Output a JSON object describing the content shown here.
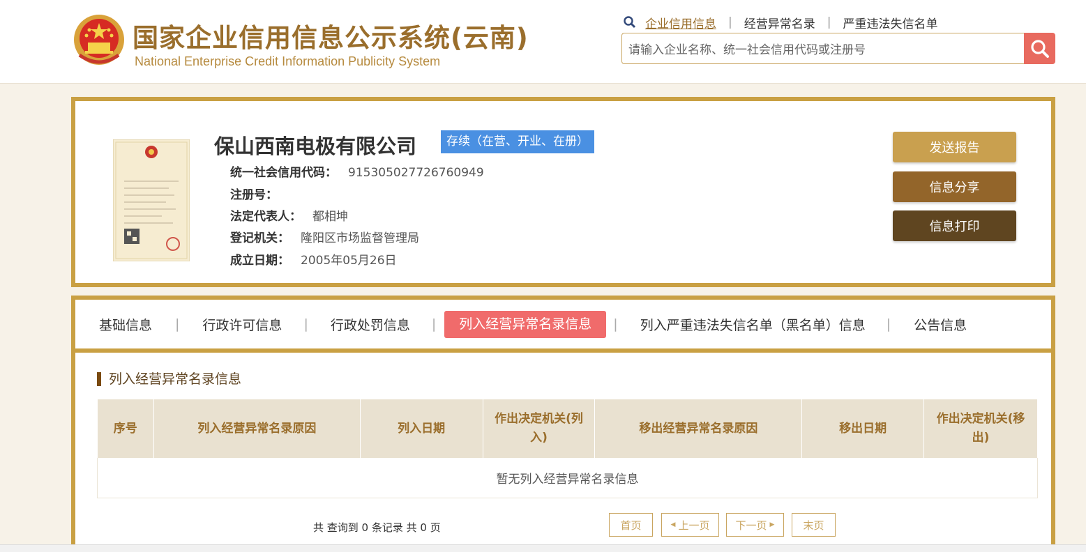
{
  "header": {
    "title": "国家企业信用信息公示系统(云南)",
    "subtitle": "National Enterprise Credit Information Publicity System",
    "nav": [
      "企业信用信息",
      "经营异常名录",
      "严重违法失信名单"
    ],
    "search_placeholder": "请输入企业名称、统一社会信用代码或注册号"
  },
  "company": {
    "name": "保山西南电极有限公司",
    "status": "存续（在营、开业、在册）",
    "license_title": "营业执照",
    "fields": [
      {
        "label": "统一社会信用代码：",
        "value": "915305027726760949"
      },
      {
        "label": "注册号：",
        "value": ""
      },
      {
        "label": "法定代表人：",
        "value": "都相坤"
      },
      {
        "label": "登记机关：",
        "value": "隆阳区市场监督管理局"
      },
      {
        "label": "成立日期：",
        "value": "2005年05月26日"
      }
    ]
  },
  "actions": {
    "send_report": "发送报告",
    "share": "信息分享",
    "print": "信息打印"
  },
  "tabs": [
    "基础信息",
    "行政许可信息",
    "行政处罚信息",
    "列入经营异常名录信息",
    "列入严重违法失信名单（黑名单）信息",
    "公告信息"
  ],
  "section": {
    "title": "列入经营异常名录信息",
    "columns": [
      "序号",
      "列入经营异常名录原因",
      "列入日期",
      "作出决定机关(列入)",
      "移出经营异常名录原因",
      "移出日期",
      "作出决定机关(移出)"
    ],
    "empty_text": "暂无列入经营异常名录信息"
  },
  "pager": {
    "summary": "共 查询到 0 条记录 共 0 页",
    "first": "首页",
    "prev": "上一页",
    "next": "下一页",
    "last": "末页"
  },
  "colors": {
    "gold": "#c9a043",
    "accent_red": "#f06b6b",
    "badge_blue": "#4a90e2",
    "btn1": "#c9a04f",
    "btn2": "#93652a",
    "btn3": "#5f4520"
  }
}
